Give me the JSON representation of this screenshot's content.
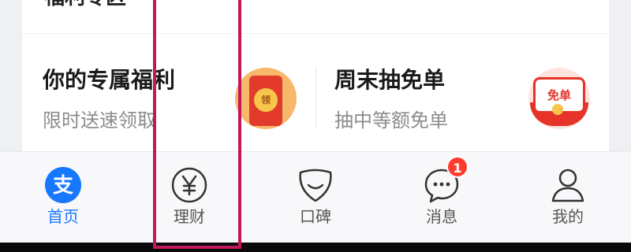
{
  "section": {
    "title": "福利专区"
  },
  "promos": [
    {
      "title": "你的专属福利",
      "subtitle": "限时送速领取",
      "icon": "red-packet-icon",
      "icon_text": "领"
    },
    {
      "title": "周末抽免单",
      "subtitle": "抽中等额免单",
      "icon": "free-coupon-icon",
      "icon_text": "免单"
    }
  ],
  "tabbar": {
    "tabs": [
      {
        "label": "首页",
        "icon": "alipay-home-icon",
        "active": true
      },
      {
        "label": "理财",
        "icon": "yuan-icon",
        "active": false
      },
      {
        "label": "口碑",
        "icon": "koubei-icon",
        "active": false
      },
      {
        "label": "消息",
        "icon": "message-icon",
        "active": false,
        "badge": "1"
      },
      {
        "label": "我的",
        "icon": "profile-icon",
        "active": false
      }
    ]
  },
  "colors": {
    "active": "#1677ff",
    "inactive_icon": "#333333",
    "highlight": "#c2185b",
    "badge": "#ff3b30"
  }
}
